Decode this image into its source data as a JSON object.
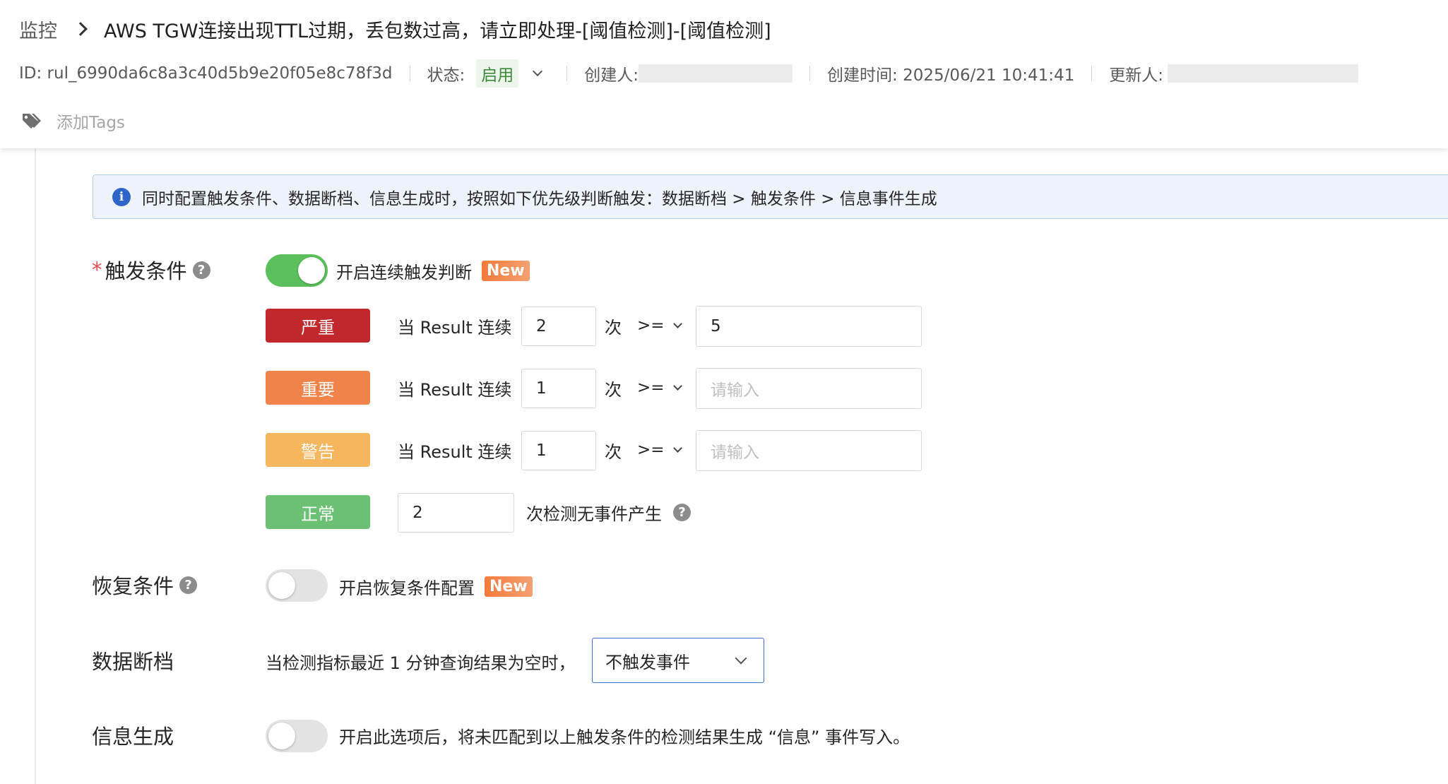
{
  "breadcrumb": {
    "root": "监控",
    "title": "AWS TGW连接出现TTL过期，丢包数过高，请立即处理-[阈值检测]-[阈值检测]"
  },
  "meta": {
    "id": "ID: rul_6990da6c8a3c40d5b9e20f05e8c78f3d",
    "status_label": "状态:",
    "status_value": "启用",
    "creator_label": "创建人:",
    "created_time": "创建时间: 2025/06/21 10:41:41",
    "updater_label": "更新人:"
  },
  "tags": {
    "add_label": "添加Tags",
    "icon": "tag-icon"
  },
  "info_banner": {
    "icon": "info-icon",
    "text": "同时配置触发条件、数据断档、信息生成时，按照如下优先级判断触发：数据断档 > 触发条件 > 信息事件生成"
  },
  "trigger": {
    "label": "触发条件",
    "required_mark": "*",
    "help_icon": "?",
    "toggle_on": true,
    "toggle_text": "开启连续触发判断",
    "new_badge": "New",
    "rows": [
      {
        "level": "严重",
        "color": "#c0282b",
        "prefix": "当 Result 连续",
        "count": "2",
        "unit": "次",
        "operator": ">=",
        "threshold": "5",
        "placeholder": "请输入"
      },
      {
        "level": "重要",
        "color": "#f0834a",
        "prefix": "当 Result 连续",
        "count": "1",
        "unit": "次",
        "operator": ">=",
        "threshold": "",
        "placeholder": "请输入"
      },
      {
        "level": "警告",
        "color": "#f6b65e",
        "prefix": "当 Result 连续",
        "count": "1",
        "unit": "次",
        "operator": ">=",
        "threshold": "",
        "placeholder": "请输入"
      }
    ],
    "normal": {
      "level": "正常",
      "color": "#6cc073",
      "count": "2",
      "text": "次检测无事件产生"
    }
  },
  "recovery": {
    "label": "恢复条件",
    "toggle_on": false,
    "toggle_text": "开启恢复条件配置",
    "new_badge": "New"
  },
  "data_gap": {
    "label": "数据断档",
    "text": "当检测指标最近 1 分钟查询结果为空时，",
    "select_value": "不触发事件"
  },
  "info_gen": {
    "label": "信息生成",
    "toggle_on": false,
    "text": "开启此选项后，将未匹配到以上触发条件的检测结果生成 “信息” 事件写入。"
  }
}
